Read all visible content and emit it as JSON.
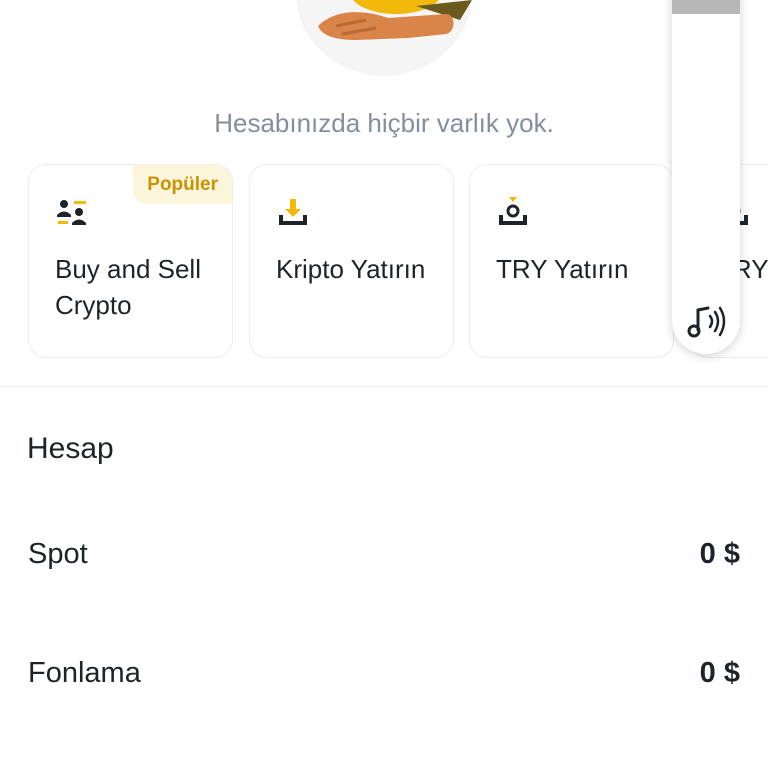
{
  "empty_state": {
    "message": "Hesabınızda hiçbir varlık yok."
  },
  "cards": [
    {
      "label": "Buy and Sell Crypto",
      "icon": "users-exchange-icon",
      "badge": "Popüler"
    },
    {
      "label": "Kripto Yatırın",
      "icon": "download-tray-icon"
    },
    {
      "label": "TRY Yatırın",
      "icon": "deposit-fiat-icon"
    },
    {
      "label": "TRY Kripto",
      "icon": "deposit-fiat-icon"
    }
  ],
  "account": {
    "title": "Hesap",
    "rows": [
      {
        "name": "Spot",
        "value": "0 $"
      },
      {
        "name": "Fonlama",
        "value": "0 $"
      }
    ]
  },
  "colors": {
    "accent": "#f0b90b",
    "badge_text": "#c99400",
    "badge_bg": "#fdf6dd",
    "muted_text": "#848e9c",
    "primary_text": "#1e2329"
  },
  "floating_panel": {
    "icon": "sound-wave-icon"
  }
}
